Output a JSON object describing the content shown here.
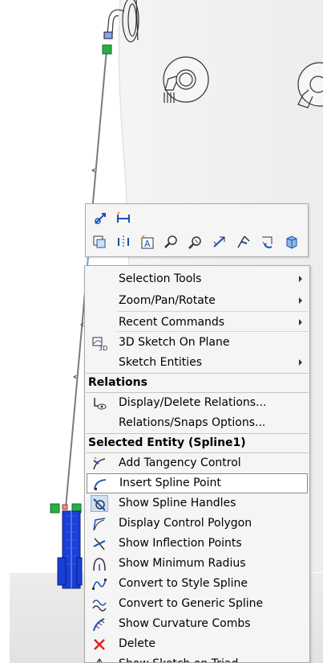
{
  "context_toolbar": {
    "row1": [
      "smart-dimension-icon",
      "horizontal-dimension-icon"
    ],
    "row2": [
      "copy-entities-icon",
      "mirror-entities-icon",
      "sketch-text-icon",
      "zoom-to-selection-icon",
      "zoom-to-area-icon",
      "rotate-view-icon",
      "orient-normal-icon",
      "undo-rotate-icon",
      "view-3d-icon"
    ]
  },
  "context_menu": {
    "items_top": [
      {
        "label": "Selection Tools",
        "submenu": true
      },
      {
        "label": "Zoom/Pan/Rotate",
        "submenu": true
      },
      {
        "label": "Recent Commands",
        "submenu": true
      },
      {
        "label": "3D Sketch On Plane",
        "submenu": false,
        "icon": "3d-sketch-icon"
      },
      {
        "label": "Sketch Entities",
        "submenu": true
      }
    ],
    "relations_header": "Relations",
    "relations_items": [
      {
        "label": "Display/Delete Relations...",
        "icon": "display-relations-icon"
      },
      {
        "label": "Relations/Snaps Options..."
      }
    ],
    "selected_header": "Selected Entity (Spline1)",
    "selected_items": [
      {
        "label": "Add Tangency Control",
        "icon": "tangency-control-icon"
      },
      {
        "label": "Insert Spline Point",
        "icon": "insert-spline-point-icon",
        "highlighted": true
      },
      {
        "label": "Show Spline Handles",
        "icon": "spline-handles-icon",
        "checked": true
      },
      {
        "label": "Display Control Polygon",
        "icon": "control-polygon-icon"
      },
      {
        "label": "Show Inflection Points",
        "icon": "inflection-points-icon"
      },
      {
        "label": "Show Minimum Radius",
        "icon": "minimum-radius-icon"
      },
      {
        "label": "Convert to Style Spline",
        "icon": "style-spline-icon"
      },
      {
        "label": "Convert to Generic Spline",
        "icon": "generic-spline-icon"
      },
      {
        "label": "Show Curvature Combs",
        "icon": "curvature-combs-icon"
      },
      {
        "label": "Delete",
        "icon": "delete-icon"
      },
      {
        "label": "Show Sketch on Triad",
        "icon": "triad-icon"
      }
    ]
  },
  "colors": {
    "accent_blue": "#1a3fd6",
    "delete_red": "#d9261c",
    "handle_green": "#27b043"
  }
}
